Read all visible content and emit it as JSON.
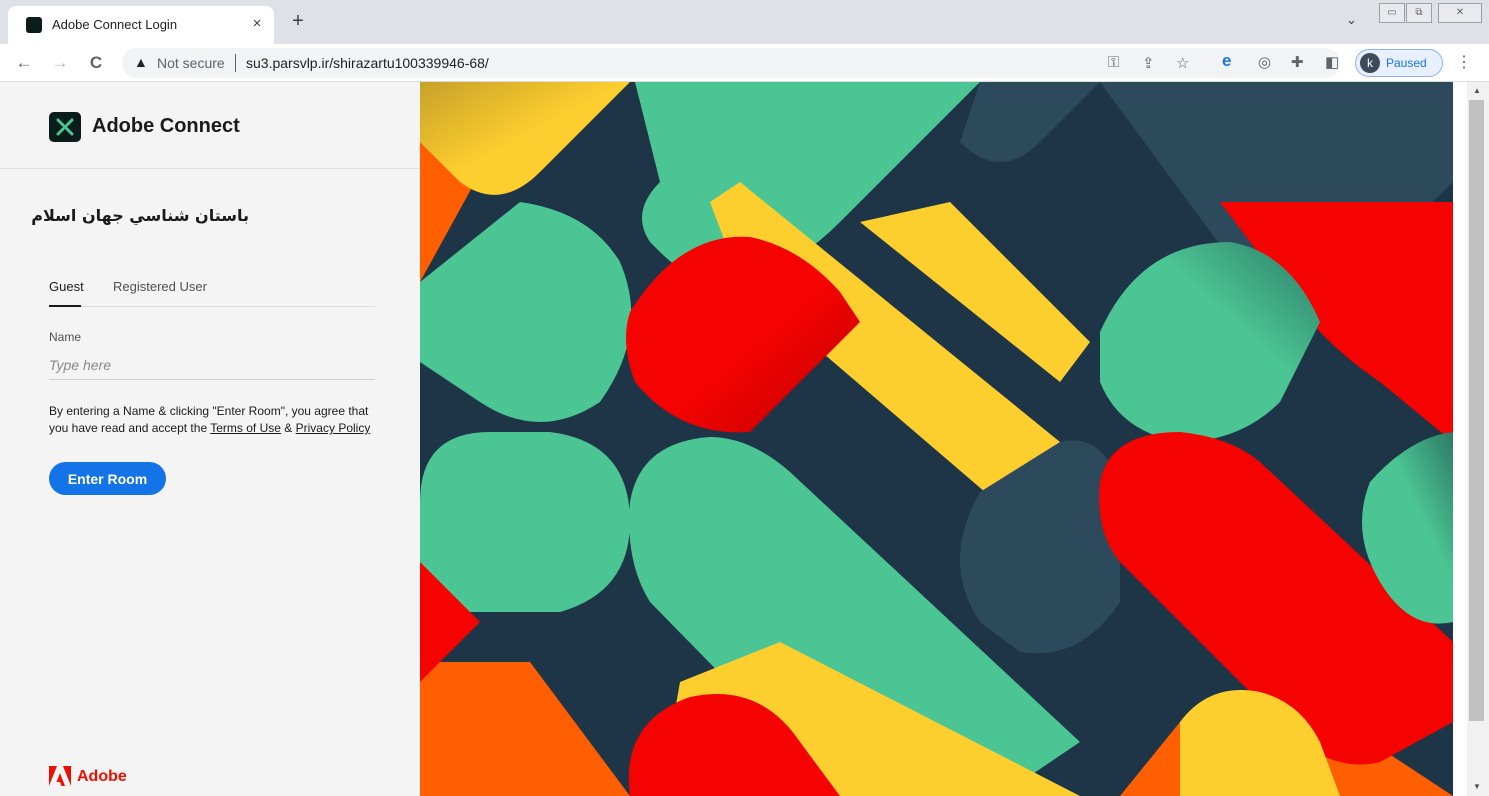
{
  "browser": {
    "tab_title": "Adobe Connect Login",
    "tab_close": "×",
    "new_tab": "+",
    "tab_menu": "⌄",
    "window_controls": [
      "▭",
      "⧉",
      "✕"
    ],
    "nav": {
      "back": "←",
      "forward": "→",
      "reload": "C"
    },
    "security_label": "Not secure",
    "url": "su3.parsvlp.ir/shirazartu100339946-68/",
    "profile_initial": "k",
    "profile_status": "Paused"
  },
  "page": {
    "brand_name": "Adobe Connect",
    "room_name": "باستان شناسي جهان اسلام",
    "tabs": [
      "Guest",
      "Registered User"
    ],
    "active_tab": "Guest",
    "name_label": "Name",
    "name_placeholder": "Type here",
    "name_value": "",
    "legal_prefix": "By entering a Name & clicking \"Enter Room\", you agree that you have read and accept the",
    "terms_link": "Terms of Use",
    "legal_and": "&",
    "privacy_link": "Privacy Policy",
    "enter_button": "Enter Room",
    "footer_brand": "Adobe"
  },
  "colors": {
    "primary_button": "#1473e6",
    "adobe_red": "#eb1000",
    "art_navy": "#1d3547",
    "art_green": "#4cc594",
    "art_yellow": "#fdcf2e",
    "art_red": "#f50300",
    "art_orange": "#ff5f00",
    "art_slate": "#2d4a5c"
  }
}
